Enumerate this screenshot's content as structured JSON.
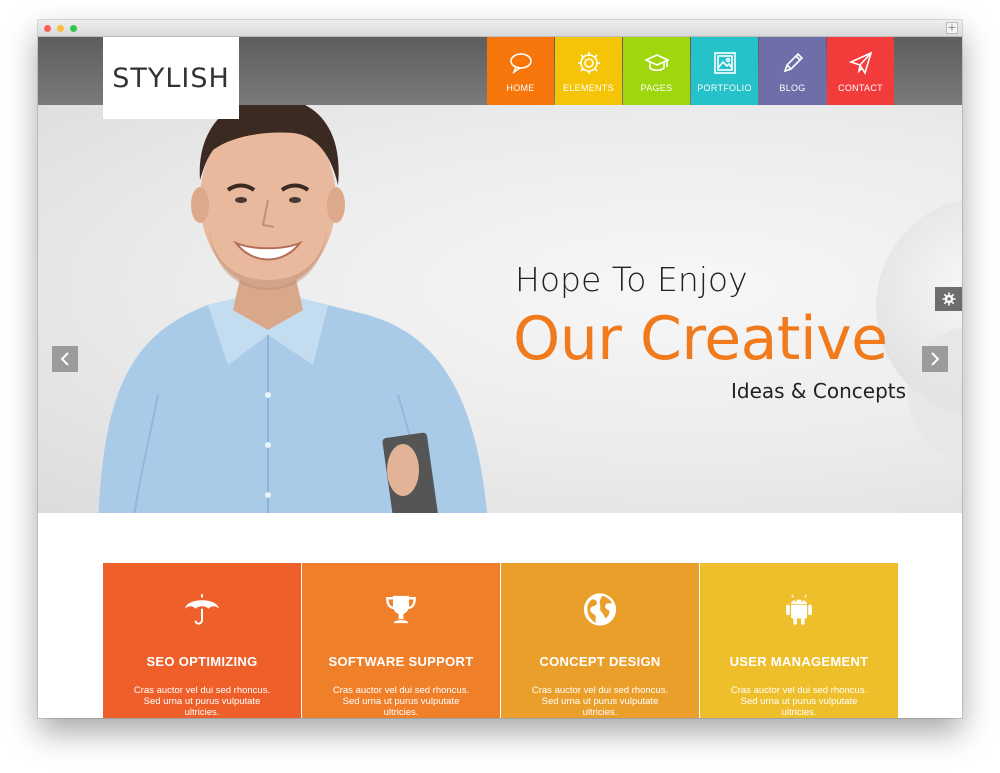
{
  "logo": {
    "text": "STYLISH"
  },
  "nav": [
    {
      "label": "HOME",
      "icon": "chat-bubble-icon",
      "color": "#f7760b"
    },
    {
      "label": "ELEMENTS",
      "icon": "gear-icon",
      "color": "#f5c406"
    },
    {
      "label": "PAGES",
      "icon": "graduation-cap-icon",
      "color": "#9fd60d"
    },
    {
      "label": "PORTFOLIO",
      "icon": "image-icon",
      "color": "#25c2c9"
    },
    {
      "label": "BLOG",
      "icon": "pencil-icon",
      "color": "#6e6ea8"
    },
    {
      "label": "CONTACT",
      "icon": "paper-plane-icon",
      "color": "#f23b3b"
    }
  ],
  "hero": {
    "line1": "Hope To Enjoy",
    "line2": "Our Creative",
    "line3": "Ideas & Concepts",
    "accent_color": "#f07a1c"
  },
  "features": [
    {
      "title": "SEO OPTIMIZING",
      "text": "Cras auctor vel dui sed rhoncus. Sed urna ut purus vulputate ultricies.",
      "icon": "umbrella-icon",
      "color": "#ee5f2a"
    },
    {
      "title": "SOFTWARE SUPPORT",
      "text": "Cras auctor vel dui sed rhoncus. Sed urna ut purus vulputate ultricies.",
      "icon": "trophy-icon",
      "color": "#f07f2a"
    },
    {
      "title": "CONCEPT DESIGN",
      "text": "Cras auctor vel dui sed rhoncus. Sed urna ut purus vulputate ultricies.",
      "icon": "globe-icon",
      "color": "#eb9f2b"
    },
    {
      "title": "USER MANAGEMENT",
      "text": "Cras auctor vel dui sed rhoncus. Sed urna ut purus vulputate ultricies.",
      "icon": "android-icon",
      "color": "#eebf2b"
    }
  ]
}
